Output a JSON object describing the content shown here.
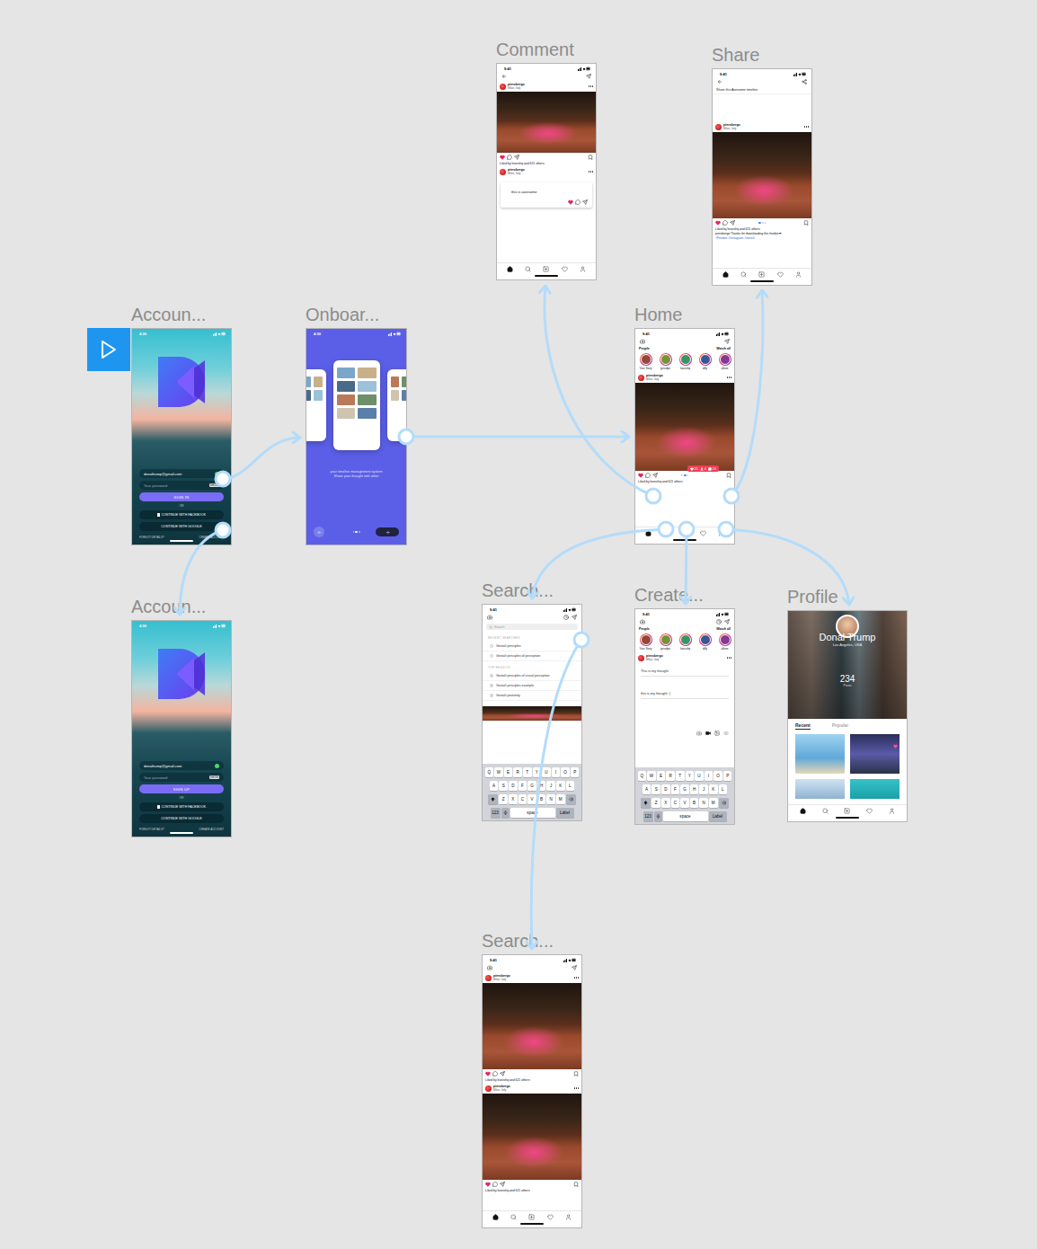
{
  "frames": [
    {
      "kind": "comment",
      "title": "Comment",
      "time": "9:41",
      "post": {
        "user": "pierobergo",
        "location": "Milan, Italy",
        "liked": "Liked by leovishq and 621 others"
      },
      "commenter": {
        "user": "pierobergo",
        "location": "Milan, Italy"
      },
      "comment": "this is awesome"
    },
    {
      "kind": "share",
      "title": "Share",
      "time": "9:41",
      "share_text": "Share this Awesome timeline",
      "post": {
        "user": "pierobergo",
        "location": "Milan, Italy",
        "liked": "Liked by leovishq and 621 others"
      },
      "caption": "pierobergo Thanks for downloading this freebie❤",
      "tags": "#Freebie #Instagram #sketch",
      "pager_dots": [
        {
          "selected": true
        },
        {
          "selected": false
        },
        {
          "selected": false
        }
      ]
    },
    {
      "kind": "account",
      "title": "Accoun...",
      "time": "4:30",
      "email": "donaltrump@gmail.com",
      "password_placeholder": "Your password",
      "password_toggle": "SHOW",
      "primary_button": "SIGN IN",
      "divider": "OR",
      "facebook_button": "CONTINUE WITH FACEBOOK",
      "google_button": "CONTINUE WITH GOOGLE",
      "footer": [
        "FORGOT DETAILS?",
        "CREATE ACCOUNT"
      ]
    },
    {
      "kind": "onboarding",
      "title": "Onboar...",
      "time": "4:30",
      "lines": [
        "your timeline management system",
        "Share your thought with other"
      ],
      "pager_dots": [
        {
          "selected": false
        },
        {
          "selected": true
        },
        {
          "selected": false
        }
      ]
    },
    {
      "kind": "home",
      "title": "Home",
      "time": "9:41",
      "people": "People",
      "watch_all": "Watch all",
      "stories": [
        {
          "name": "Your Story"
        },
        {
          "name": "gesrdpe"
        },
        {
          "name": "leovishq"
        },
        {
          "name": "dilly"
        },
        {
          "name": "allene"
        }
      ],
      "post": {
        "user": "pierobergo",
        "location": "Milan, Italy",
        "liked": "Liked by leovishq and 621 others"
      },
      "pager_dots": [
        {
          "selected": false
        },
        {
          "selected": true
        },
        {
          "selected": false
        }
      ],
      "badge": [
        {
          "kind": "likes",
          "value": "21"
        },
        {
          "kind": "followers",
          "value": "4"
        },
        {
          "kind": "comments",
          "value": "24"
        }
      ]
    },
    {
      "kind": "account",
      "title": "Accoun...",
      "time": "4:30",
      "email": "donaltrump@gmail.com",
      "password_placeholder": "Your password",
      "password_toggle": "SHOW",
      "primary_button": "SIGN UP",
      "divider": "OR",
      "facebook_button": "CONTINUE WITH FACEBOOK",
      "google_button": "CONTINUE WITH GOOGLE",
      "footer": [
        "FORGOT DETAILS?",
        "CREATE ACCOUNT"
      ]
    },
    {
      "kind": "search",
      "title": "Search...",
      "time": "9:41",
      "placeholder": "Search",
      "recent_heading": "RECENT SEARCHES",
      "recent": [
        "Gestalt principles",
        "Gestalt principles of perception"
      ],
      "top_heading": "TOP RESULTS",
      "results": [
        "Gestalt principles of visual perception",
        "Gestalt principles example",
        "Gestalt proximity"
      ],
      "keyboard": {
        "rows": [
          [
            "Q",
            "W",
            "E",
            "R",
            "T",
            "Y",
            "U",
            "I",
            "O",
            "P"
          ],
          [
            "A",
            "S",
            "D",
            "F",
            "G",
            "H",
            "J",
            "K",
            "L"
          ],
          [
            "Z",
            "X",
            "C",
            "V",
            "B",
            "N",
            "M"
          ]
        ],
        "number_key": "123",
        "space_key": "space",
        "return_key": "Label"
      }
    },
    {
      "kind": "create",
      "title": "Create...",
      "time": "9:41",
      "people": "People",
      "watch_all": "Watch all",
      "stories": [
        {
          "name": "Your Story"
        },
        {
          "name": "gesrdpe"
        },
        {
          "name": "leovishq"
        },
        {
          "name": "dilly"
        },
        {
          "name": "allene"
        }
      ],
      "author": {
        "user": "pierobergo",
        "location": "Milan, Italy"
      },
      "inputs": [
        "This is my thought",
        "this is my thought :)"
      ],
      "keyboard": {
        "rows": [
          [
            "Q",
            "W",
            "E",
            "R",
            "T",
            "Y",
            "U",
            "I",
            "O",
            "P"
          ],
          [
            "A",
            "S",
            "D",
            "F",
            "G",
            "H",
            "J",
            "K",
            "L"
          ],
          [
            "Z",
            "X",
            "C",
            "V",
            "B",
            "N",
            "M"
          ]
        ],
        "number_key": "123",
        "space_key": "space",
        "return_key": "Label"
      }
    },
    {
      "kind": "profile",
      "title": "Profile",
      "name": "Donal Trump",
      "location": "Los Angeles, USA",
      "count": "234",
      "count_label": "Posts",
      "tabs": [
        {
          "label": "Recent",
          "selected": true
        },
        {
          "label": "Popular",
          "selected": false
        }
      ]
    },
    {
      "kind": "feed",
      "title": "Search...",
      "time": "9:41",
      "posts": [
        {
          "user": "pierobergo",
          "location": "Milan, Italy",
          "liked": "Liked by leovishq and 621 others"
        },
        {
          "user": "pierobergo",
          "location": "Milan, Italy",
          "liked": "Liked by leovishq and 621 others"
        }
      ]
    }
  ]
}
